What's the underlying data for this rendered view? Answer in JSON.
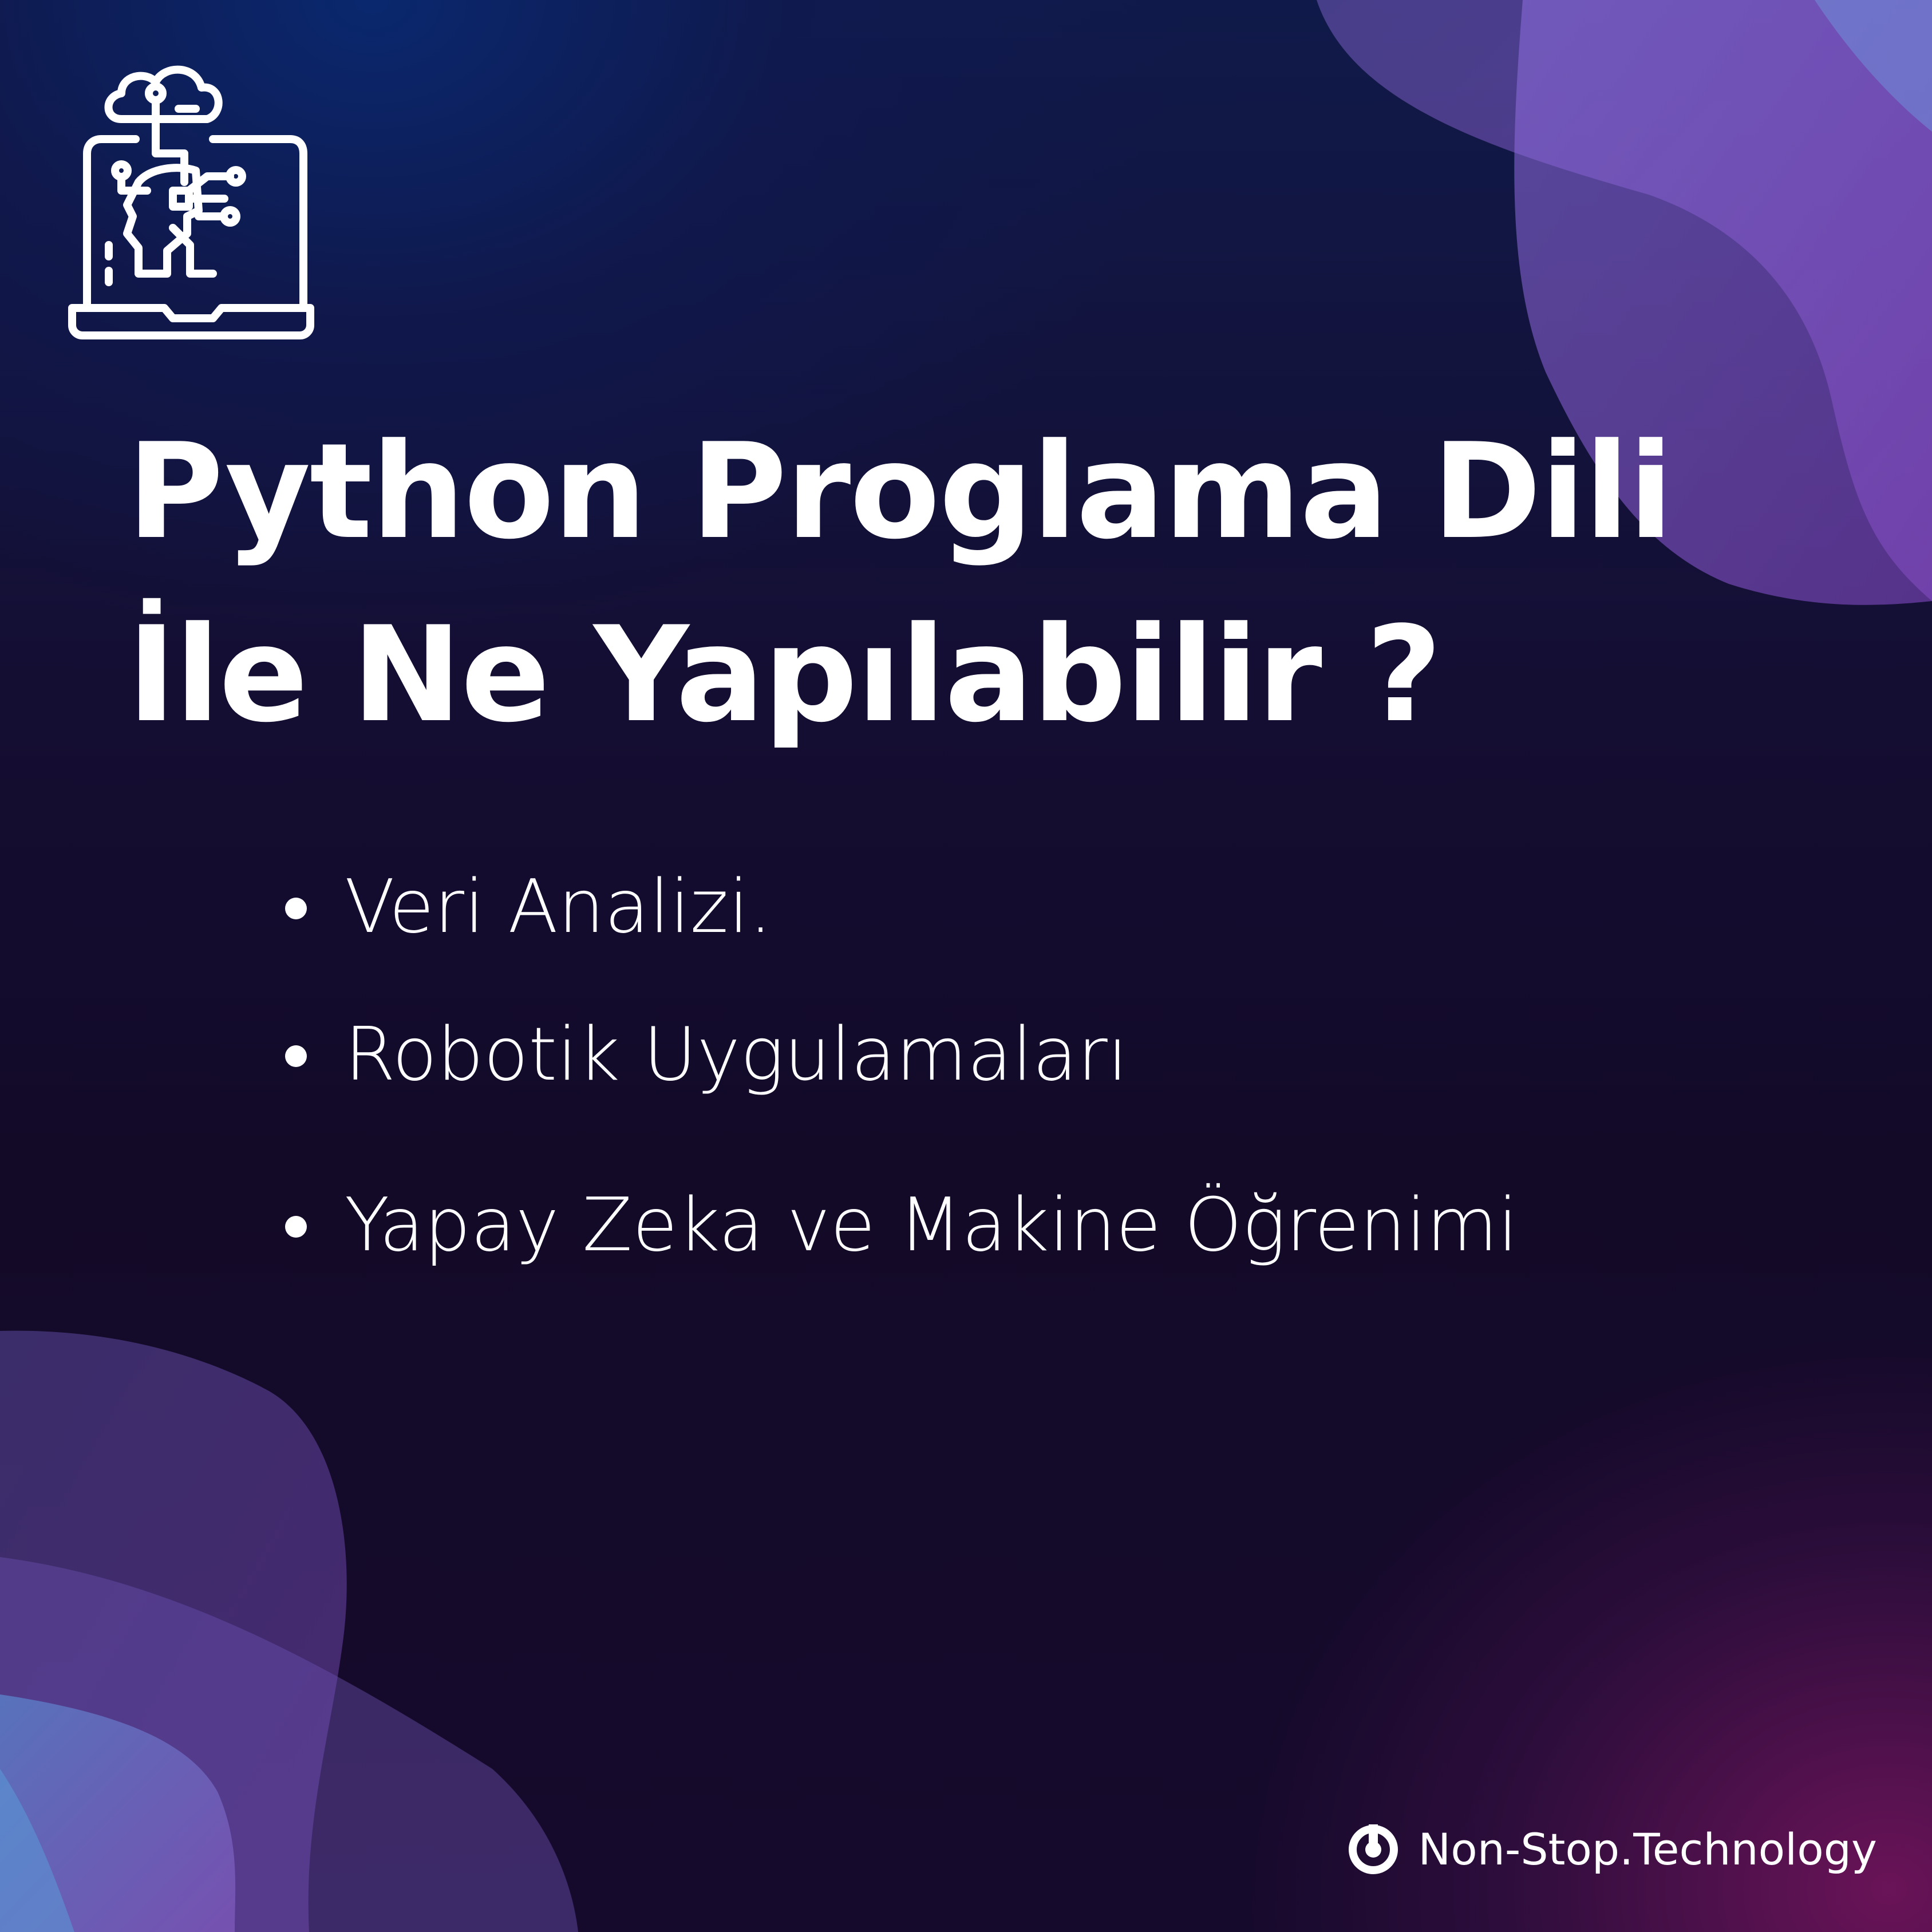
{
  "title": {
    "line1": "Python Proglama Dili",
    "line2": "İle Ne Yapılabilir ?"
  },
  "bullets": [
    "Veri Analizi.",
    "Robotik Uygulamaları",
    "Yapay Zeka ve Makine Öğrenimi"
  ],
  "brand": {
    "name": "Non-Stop.Technology"
  },
  "icons": {
    "header": "laptop-ai-cloud-icon",
    "brand": "brand-logo-icon"
  },
  "colors": {
    "text": "#ffffff",
    "blob_purple": "#7a5cc8",
    "blob_blue": "#5b8fd6",
    "background_top": "#0d1f5c",
    "background_bottom_right": "#6a1451"
  }
}
